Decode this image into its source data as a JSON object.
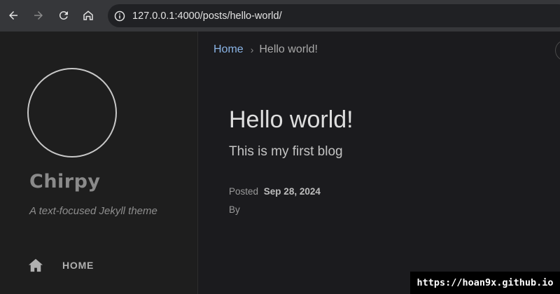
{
  "browser": {
    "url": "127.0.0.1:4000/posts/hello-world/",
    "icons": [
      "back-arrow-icon",
      "forward-arrow-icon",
      "reload-icon",
      "home-icon",
      "site-info-icon"
    ]
  },
  "sidebar": {
    "site_title": "Chirpy",
    "site_subtitle": "A text-focused Jekyll theme",
    "nav": [
      {
        "label": "HOME",
        "icon": "home-icon"
      }
    ]
  },
  "breadcrumb": {
    "home": "Home",
    "separator": "›",
    "current": "Hello world!"
  },
  "post": {
    "title": "Hello world!",
    "description": "This is my first blog",
    "posted_label": "Posted",
    "date": "Sep 28, 2024",
    "author_label": "By"
  },
  "watermark": "https://hoan9x.github.io",
  "colors": {
    "background": "#1b1b1e",
    "sidebar": "#1e1e1e",
    "link": "#8ab4e6",
    "toolbar": "#36373a"
  }
}
